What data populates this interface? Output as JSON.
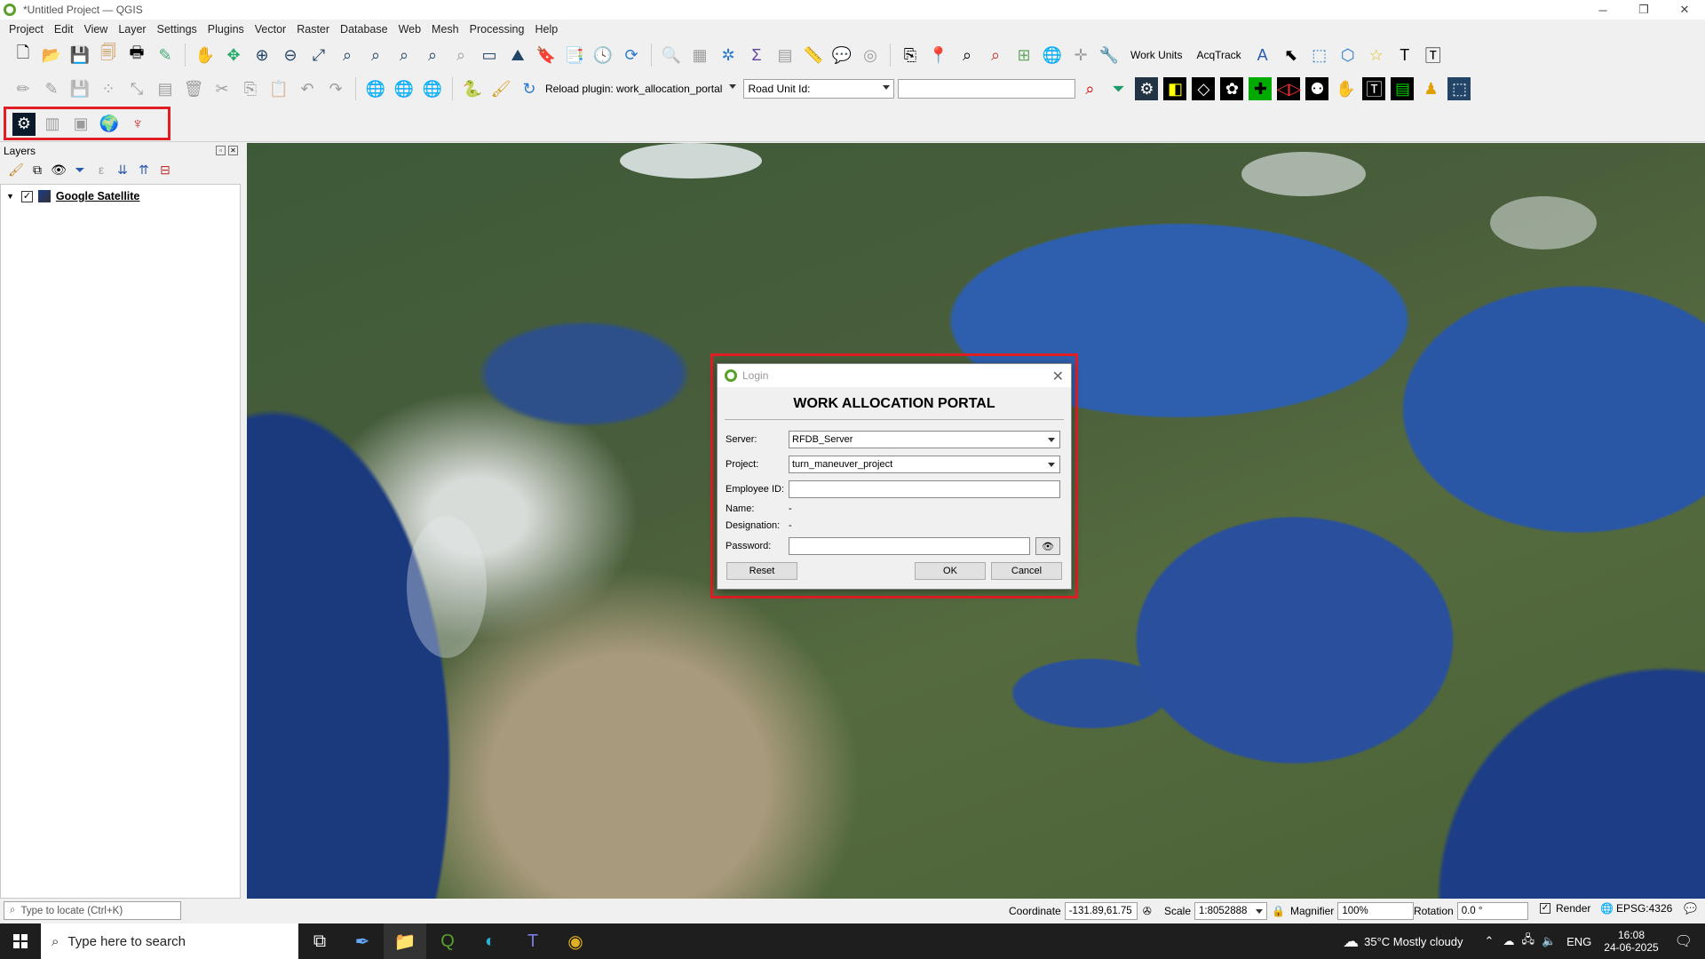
{
  "window": {
    "title": "*Untitled Project — QGIS",
    "controls": [
      "─",
      "❐",
      "✕"
    ]
  },
  "menu": [
    "Project",
    "Edit",
    "View",
    "Layer",
    "Settings",
    "Plugins",
    "Vector",
    "Raster",
    "Database",
    "Web",
    "Mesh",
    "Processing",
    "Help"
  ],
  "toolbar1": {
    "work_units": "Work Units",
    "acqtrack": "AcqTrack"
  },
  "toolbar2": {
    "reload_plugin": "Reload plugin: work_allocation_portal",
    "road_unit_combo": "Road Unit Id:",
    "road_unit_value": ""
  },
  "layers_panel": {
    "title": "Layers",
    "layers": [
      {
        "name": "Google Satellite",
        "checked": true
      }
    ]
  },
  "dialog": {
    "title": "Login",
    "heading": "WORK ALLOCATION PORTAL",
    "server_label": "Server:",
    "server_value": "RFDB_Server",
    "project_label": "Project:",
    "project_value": "turn_maneuver_project",
    "employee_label": "Employee ID:",
    "employee_value": "",
    "name_label": "Name:",
    "name_value": "-",
    "designation_label": "Designation:",
    "designation_value": "-",
    "password_label": "Password:",
    "password_value": "",
    "reset": "Reset",
    "ok": "OK",
    "cancel": "Cancel"
  },
  "statusbar": {
    "locator_placeholder": "Type to locate (Ctrl+K)",
    "coordinate_label": "Coordinate",
    "coordinate_value": "-131.89,61.75",
    "scale_label": "Scale",
    "scale_value": "1:8052888",
    "magnifier_label": "Magnifier",
    "magnifier_value": "100%",
    "rotation_label": "Rotation",
    "rotation_value": "0.0 °",
    "render_label": "Render",
    "crs": "EPSG:4326"
  },
  "taskbar": {
    "search_placeholder": "Type here to search",
    "weather": "35°C  Mostly cloudy",
    "lang": "ENG",
    "time": "16:08",
    "date": "24-06-2025"
  },
  "colors": {
    "highlight_border": "#e01e24",
    "qgis_green": "#5aa02c"
  }
}
